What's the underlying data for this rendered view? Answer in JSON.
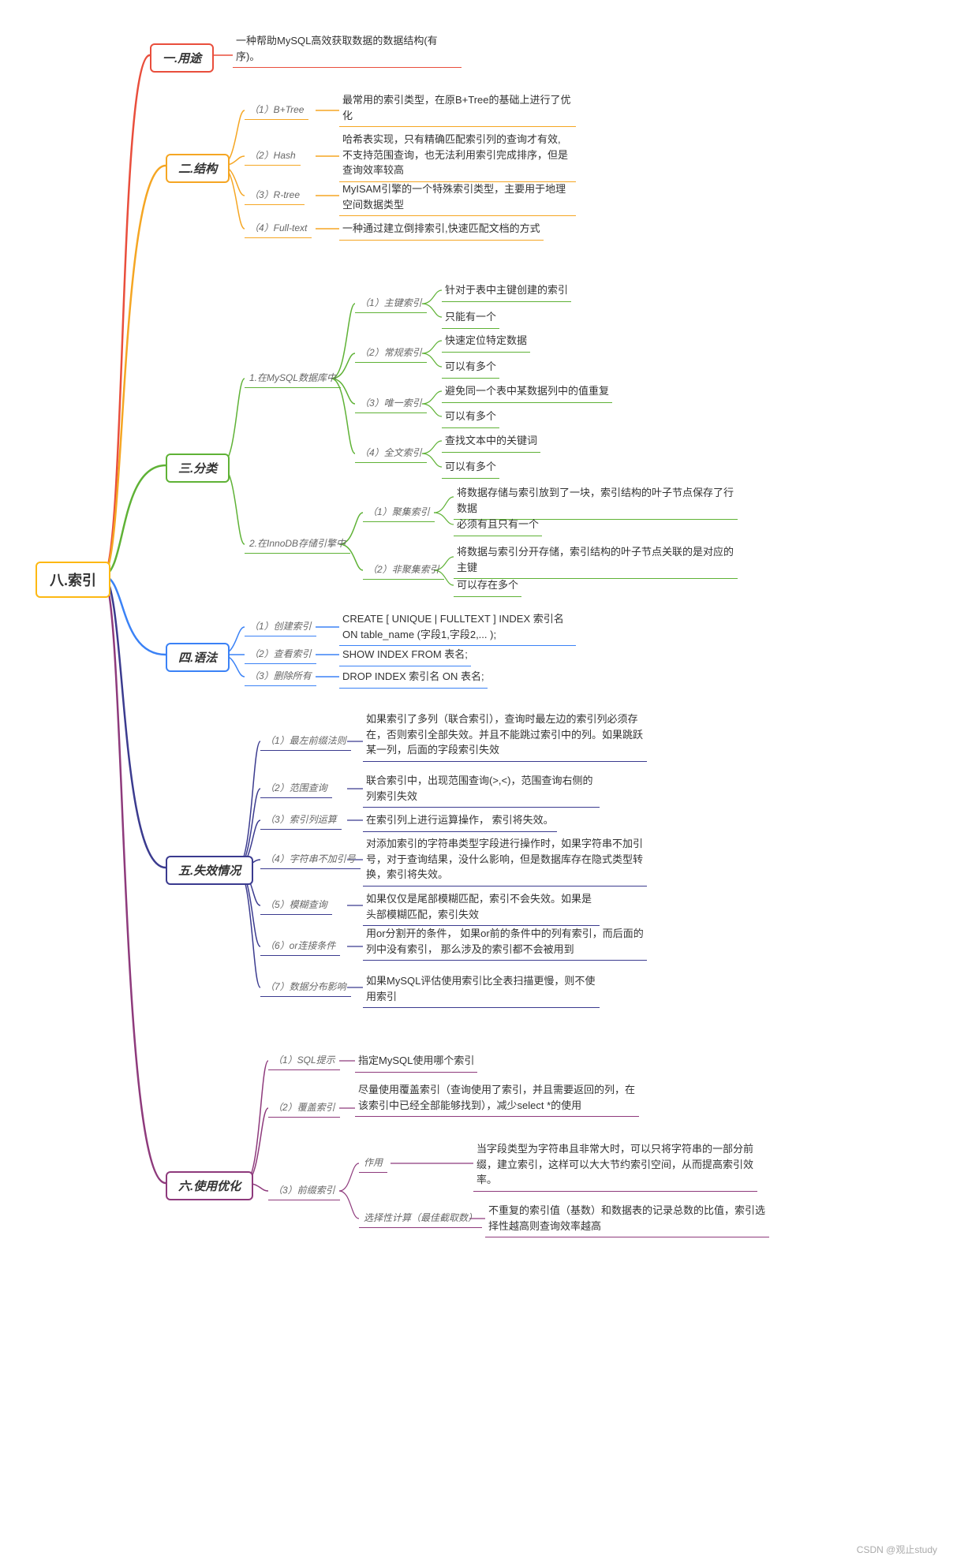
{
  "root": "八.索引",
  "branches": {
    "b1": {
      "title": "一.用途",
      "color": "#e94e3c",
      "desc": "一种帮助MySQL高效获取数据的数据结构(有序)。"
    },
    "b2": {
      "title": "二.结构",
      "color": "#f5a623",
      "items": [
        {
          "k": "（1）B+Tree",
          "v": "最常用的索引类型，在原B+Tree的基础上进行了优化"
        },
        {
          "k": "（2）Hash",
          "v": "哈希表实现，只有精确匹配索引列的查询才有效, 不支持范围查询，也无法利用索引完成排序，但是查询效率较高"
        },
        {
          "k": "（3）R-tree",
          "v": "MyISAM引擎的一个特殊索引类型，主要用于地理空间数据类型"
        },
        {
          "k": "（4）Full-text",
          "v": "一种通过建立倒排索引,快速匹配文档的方式"
        }
      ]
    },
    "b3": {
      "title": "三.分类",
      "color": "#5fb236",
      "g1": {
        "label": "1.在MySQL数据库中",
        "items": [
          {
            "k": "（1）主键索引",
            "v": [
              "针对于表中主键创建的索引",
              "只能有一个"
            ]
          },
          {
            "k": "（2）常规索引",
            "v": [
              "快速定位特定数据",
              "可以有多个"
            ]
          },
          {
            "k": "（3）唯一索引",
            "v": [
              "避免同一个表中某数据列中的值重复",
              "可以有多个"
            ]
          },
          {
            "k": "（4）全文索引",
            "v": [
              "查找文本中的关键词",
              "可以有多个"
            ]
          }
        ]
      },
      "g2": {
        "label": "2.在InnoDB存储引擎中",
        "items": [
          {
            "k": "（1）聚集索引",
            "v": [
              "将数据存储与索引放到了一块，索引结构的叶子节点保存了行数据",
              "必须有且只有一个"
            ]
          },
          {
            "k": "（2）非聚集索引",
            "v": [
              "将数据与索引分开存储，索引结构的叶子节点关联的是对应的主键",
              "可以存在多个"
            ]
          }
        ]
      }
    },
    "b4": {
      "title": "四.语法",
      "color": "#3b82f6",
      "items": [
        {
          "k": "（1）创建索引",
          "v": "CREATE [ UNIQUE | FULLTEXT ] INDEX 索引名 ON table_name (字段1,字段2,... );"
        },
        {
          "k": "（2）查看索引",
          "v": "SHOW  INDEX  FROM  表名;"
        },
        {
          "k": "（3）删除所有",
          "v": "DROP INDEX 索引名 ON 表名;"
        }
      ]
    },
    "b5": {
      "title": "五.失效情况",
      "color": "#3b3b8f",
      "items": [
        {
          "k": "（1）最左前缀法则",
          "v": "如果索引了多列（联合索引），查询时最左边的索引列必须存在，否则索引全部失效。并且不能跳过索引中的列。如果跳跃某一列，后面的字段索引失效"
        },
        {
          "k": "（2）范围查询",
          "v": "联合索引中，出现范围查询(>,<)，范围查询右侧的列索引失效"
        },
        {
          "k": "（3）索引列运算",
          "v": "在索引列上进行运算操作， 索引将失效。"
        },
        {
          "k": "（4）字符串不加引号",
          "v": "对添加索引的字符串类型字段进行操作时，如果字符串不加引号，对于查询结果，没什么影响，但是数据库存在隐式类型转换，索引将失效。"
        },
        {
          "k": "（5）模糊查询",
          "v": "如果仅仅是尾部模糊匹配，索引不会失效。如果是头部模糊匹配，索引失效"
        },
        {
          "k": "（6）or连接条件",
          "v": "用or分割开的条件， 如果or前的条件中的列有索引，而后面的列中没有索引， 那么涉及的索引都不会被用到"
        },
        {
          "k": "（7）数据分布影响",
          "v": "如果MySQL评估使用索引比全表扫描更慢，则不使用索引"
        }
      ]
    },
    "b6": {
      "title": "六.使用优化",
      "color": "#8e3a7c",
      "items": [
        {
          "k": "（1）SQL提示",
          "v": "指定MySQL使用哪个索引"
        },
        {
          "k": "（2）覆盖索引",
          "v": "尽量使用覆盖索引（查询使用了索引，并且需要返回的列，在该索引中已经全部能够找到），减少select *的使用"
        },
        {
          "k": "（3）前缀索引",
          "sub": [
            {
              "k": "作用",
              "v": "当字段类型为字符串且非常大时，可以只将字符串的一部分前缀，建立索引，这样可以大大节约索引空间，从而提高索引效率。"
            },
            {
              "k": "选择性计算（最佳截取数）",
              "v": "不重复的索引值（基数）和数据表的记录总数的比值，索引选择性越高则查询效率越高"
            }
          ]
        }
      ]
    }
  },
  "watermark": "CSDN @观止study"
}
